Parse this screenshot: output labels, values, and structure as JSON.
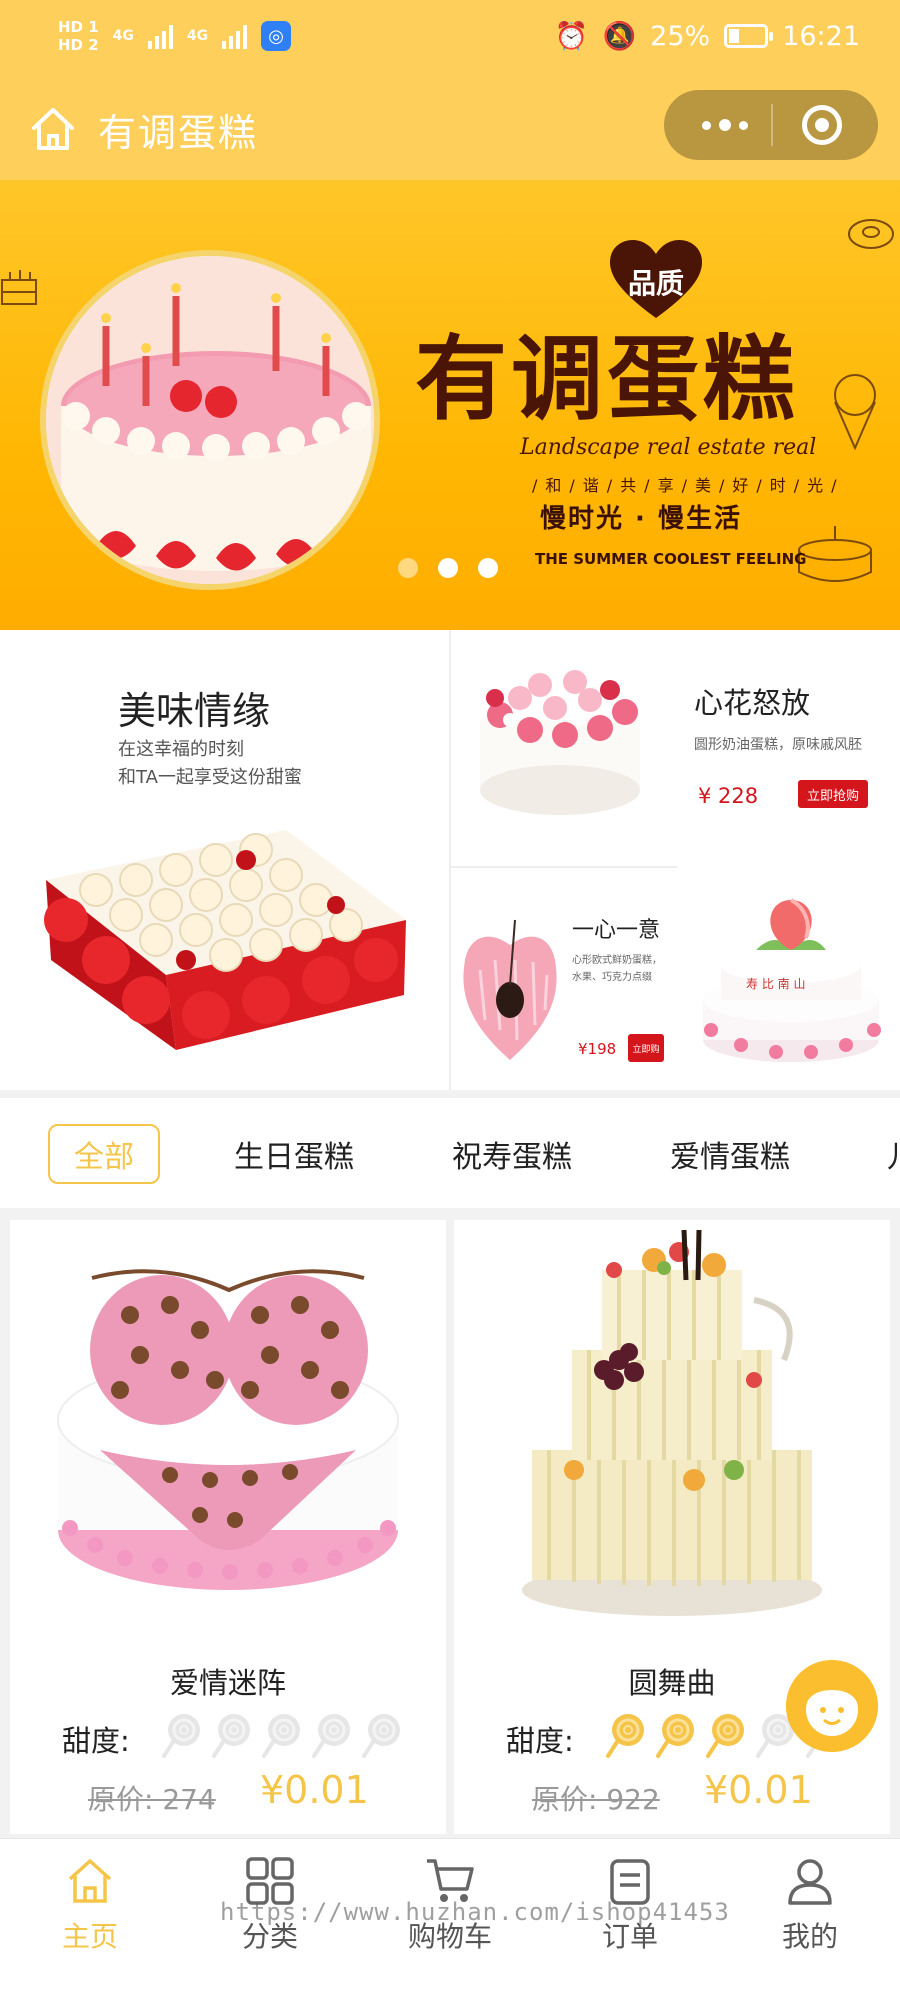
{
  "status_bar": {
    "hd1": "HD 1",
    "hd2": "HD 2",
    "net1": "4G",
    "net2": "4G",
    "battery": "25%",
    "time": "16:21"
  },
  "nav": {
    "title": "有调蛋糕"
  },
  "banner": {
    "badge": "品质",
    "title": "有调蛋糕",
    "script": "Landscape real estate real",
    "tagline_small": "/和/谐/共/享/美/好/时/光/",
    "tagline": "慢时光 · 慢生活",
    "footer": "THE SUMMER COOLEST FEELING",
    "active_dot": 2,
    "dot_count": 3
  },
  "promo": {
    "main": {
      "title": "美味情缘",
      "line1": "在这幸福的时刻",
      "line2": "和TA一起享受这份甜蜜"
    },
    "right_top": {
      "title": "心花怒放",
      "desc": "圆形奶油蛋糕，原味戚风胚",
      "price": "¥ 228",
      "button": "立即抢购"
    },
    "right_small": {
      "title": "一心一意",
      "desc": "心形欧式鲜奶蛋糕，水果、巧克力点缀",
      "price": "¥198",
      "button": "立即购"
    }
  },
  "category_tabs": [
    {
      "label": "全部",
      "active": true
    },
    {
      "label": "生日蛋糕",
      "active": false
    },
    {
      "label": "祝寿蛋糕",
      "active": false
    },
    {
      "label": "爱情蛋糕",
      "active": false
    },
    {
      "label": "儿",
      "active": false
    }
  ],
  "products": [
    {
      "name": "爱情迷阵",
      "sweet_label": "甜度:",
      "sweetness": 0,
      "sweetness_max": 5,
      "original_price": "原价: 274",
      "price": "¥0.01"
    },
    {
      "name": "圆舞曲",
      "sweet_label": "甜度:",
      "sweetness": 3,
      "sweetness_max": 5,
      "original_price": "原价: 922",
      "price": "¥0.01"
    }
  ],
  "tabbar": [
    {
      "label": "主页",
      "icon": "home-icon",
      "active": true
    },
    {
      "label": "分类",
      "icon": "grid-icon",
      "active": false
    },
    {
      "label": "购物车",
      "icon": "cart-icon",
      "active": false
    },
    {
      "label": "订单",
      "icon": "order-icon",
      "active": false
    },
    {
      "label": "我的",
      "icon": "user-icon",
      "active": false
    }
  ],
  "watermark": "https://www.huzhan.com/ishop41453",
  "colors": {
    "header": "#ffcf5c",
    "accent": "#f5c54a",
    "promo_red": "#d4161c",
    "capsule": "#b99640"
  }
}
